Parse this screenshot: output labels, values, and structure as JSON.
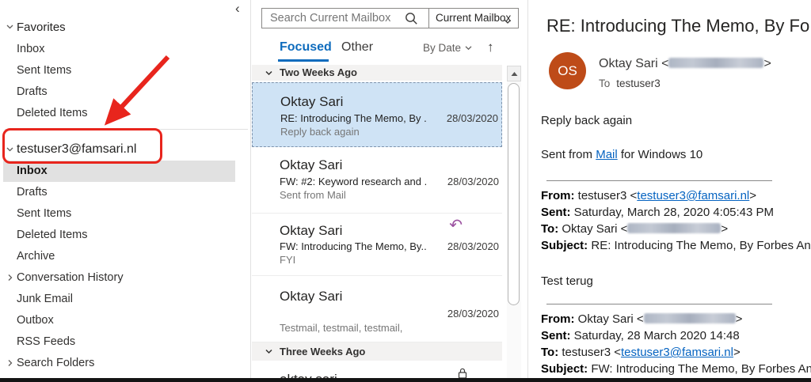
{
  "colors": {
    "accent_blue": "#0f6cbd",
    "link_blue": "#0563c1",
    "annotation_red": "#e8251d",
    "avatar_orange": "#be4b18",
    "reply_purple": "#9b51a0",
    "selected_email_bg": "#cfe3f5"
  },
  "sidebar": {
    "collapse_icon": "‹",
    "favorites_label": "Favorites",
    "fav_items": [
      "Inbox",
      "Sent Items",
      "Drafts",
      "Deleted Items"
    ],
    "account_label": "testuser3@famsari.nl",
    "acct_items": [
      "Inbox",
      "Drafts",
      "Sent Items",
      "Deleted Items",
      "Archive",
      "Conversation History",
      "Junk Email",
      "Outbox",
      "RSS Feeds",
      "Search Folders"
    ]
  },
  "list_pane": {
    "search_placeholder": "Search Current Mailbox",
    "scope": "Current Mailbox",
    "tab_focused": "Focused",
    "tab_other": "Other",
    "sort_label": "By Date",
    "sort_dir_icon": "↑",
    "group1": "Two Weeks Ago",
    "group2": "Three Weeks Ago",
    "reply_icon": "↶",
    "emails": [
      {
        "sender": "Oktay Sari",
        "subject": "RE: Introducing The Memo, By ...",
        "date": "28/03/2020",
        "preview": "Reply back again"
      },
      {
        "sender": "Oktay Sari",
        "subject": "FW: #2: Keyword research and ...",
        "date": "28/03/2020",
        "preview": "Sent from Mail"
      },
      {
        "sender": "Oktay Sari",
        "subject": "FW: Introducing The Memo, By...",
        "date": "28/03/2020",
        "preview": "FYI"
      },
      {
        "sender": "Oktay Sari",
        "subject": "",
        "date": "28/03/2020",
        "preview": "Testmail, testmail, testmail,"
      },
      {
        "sender": "oktay sari",
        "subject": "",
        "date": "",
        "preview": ""
      }
    ]
  },
  "reading_pane": {
    "title": "RE: Introducing The Memo, By Fo",
    "avatar_initials": "OS",
    "sender_pre": "Oktay Sari <",
    "sender_post": ">",
    "to_label": "To",
    "to_value": "testuser3",
    "reply_text": "Reply back again",
    "sent_from_pre": "Sent from ",
    "sent_from_link": "Mail",
    "sent_from_post": " for Windows 10",
    "quote1": {
      "from_label": "From:",
      "from_pre": " testuser3 <",
      "from_link": "testuser3@famsari.nl",
      "from_post": ">",
      "sent_label": "Sent:",
      "sent_value": " Saturday, March 28, 2020 4:05:43 PM",
      "to_label": "To:",
      "to_pre": " Oktay Sari <",
      "to_post": ">",
      "subject_label": "Subject:",
      "subject_value": " RE: Introducing The Memo, By Forbes And",
      "body_text": "Test terug"
    },
    "quote2": {
      "from_label": "From:",
      "from_pre": " Oktay Sari <",
      "from_post": ">",
      "sent_label": "Sent:",
      "sent_value": " Saturday, 28 March 2020 14:48",
      "to_label": "To:",
      "to_pre": " testuser3 <",
      "to_link": "testuser3@famsari.nl",
      "to_post": ">",
      "subject_label": "Subject:",
      "subject_value": " FW: Introducing The Memo, By Forbes An"
    }
  }
}
